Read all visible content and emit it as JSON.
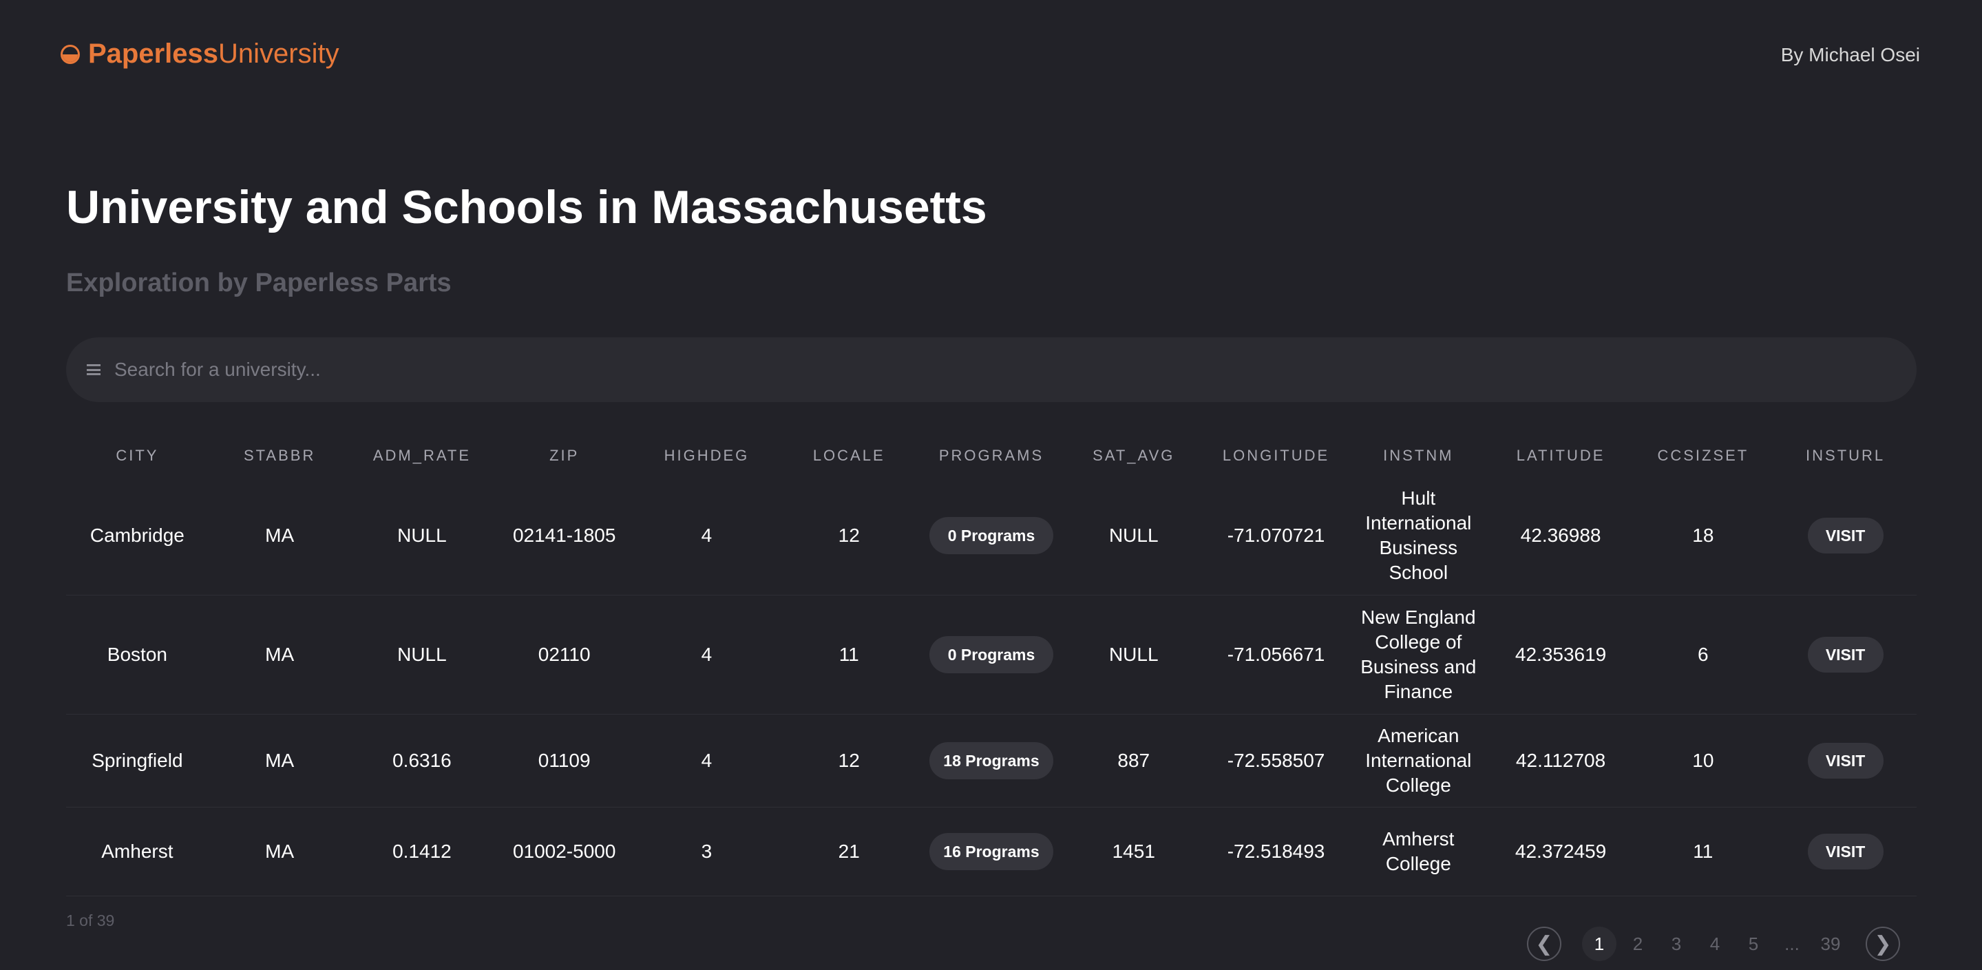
{
  "header": {
    "brand_bold": "Paperless",
    "brand_light": "University",
    "byline": "By Michael Osei"
  },
  "page": {
    "title": "University and Schools in Massachusetts",
    "subtitle": "Exploration by Paperless Parts"
  },
  "search": {
    "placeholder": "Search for a university..."
  },
  "table": {
    "columns": [
      "CITY",
      "STABBR",
      "ADM_RATE",
      "ZIP",
      "HIGHDEG",
      "LOCALE",
      "PROGRAMS",
      "SAT_AVG",
      "LONGITUDE",
      "INSTNM",
      "LATITUDE",
      "CCSIZSET",
      "INSTURL"
    ],
    "rows": [
      {
        "city": "Cambridge",
        "stabbr": "MA",
        "adm_rate": "NULL",
        "zip": "02141-1805",
        "highdeg": "4",
        "locale": "12",
        "programs": "0 Programs",
        "sat_avg": "NULL",
        "longitude": "-71.070721",
        "instnm": "Hult International Business School",
        "latitude": "42.36988",
        "ccsizset": "18",
        "visit": "VISIT"
      },
      {
        "city": "Boston",
        "stabbr": "MA",
        "adm_rate": "NULL",
        "zip": "02110",
        "highdeg": "4",
        "locale": "11",
        "programs": "0 Programs",
        "sat_avg": "NULL",
        "longitude": "-71.056671",
        "instnm": "New England College of Business and Finance",
        "latitude": "42.353619",
        "ccsizset": "6",
        "visit": "VISIT"
      },
      {
        "city": "Springfield",
        "stabbr": "MA",
        "adm_rate": "0.6316",
        "zip": "01109",
        "highdeg": "4",
        "locale": "12",
        "programs": "18 Programs",
        "sat_avg": "887",
        "longitude": "-72.558507",
        "instnm": "American International College",
        "latitude": "42.112708",
        "ccsizset": "10",
        "visit": "VISIT"
      },
      {
        "city": "Amherst",
        "stabbr": "MA",
        "adm_rate": "0.1412",
        "zip": "01002-5000",
        "highdeg": "3",
        "locale": "21",
        "programs": "16 Programs",
        "sat_avg": "1451",
        "longitude": "-72.518493",
        "instnm": "Amherst College",
        "latitude": "42.372459",
        "ccsizset": "11",
        "visit": "VISIT"
      }
    ]
  },
  "pagination": {
    "page_count": "1 of 39",
    "prev_icon": "❮",
    "next_icon": "❯",
    "pages": [
      "1",
      "2",
      "3",
      "4",
      "5",
      "...",
      "39"
    ],
    "current": "1"
  },
  "colors": {
    "accent": "#e8793a",
    "background": "#222228",
    "surface": "#2b2b31"
  }
}
